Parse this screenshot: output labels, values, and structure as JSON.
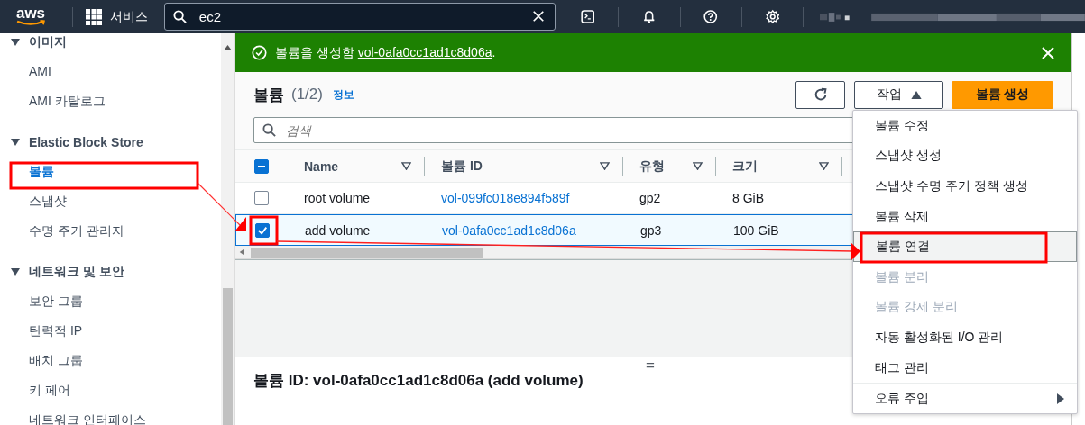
{
  "top_nav": {
    "logo": "aws",
    "services": "서비스",
    "search": {
      "value": "ec2"
    }
  },
  "sidebar": {
    "sections": [
      {
        "title": "이미지",
        "expanded": true,
        "items": [
          {
            "label": "AMI",
            "selected": false
          },
          {
            "label": "AMI 카탈로그",
            "selected": false
          }
        ]
      },
      {
        "title": "Elastic Block Store",
        "expanded": true,
        "items": [
          {
            "label": "볼륨",
            "selected": true
          },
          {
            "label": "스냅샷",
            "selected": false
          },
          {
            "label": "수명 주기 관리자",
            "selected": false
          }
        ]
      },
      {
        "title": "네트워크 및 보안",
        "expanded": true,
        "items": [
          {
            "label": "보안 그룹",
            "selected": false
          },
          {
            "label": "탄력적 IP",
            "selected": false
          },
          {
            "label": "배치 그룹",
            "selected": false
          },
          {
            "label": "키 페어",
            "selected": false
          },
          {
            "label": "네트워크 인터페이스",
            "selected": false
          }
        ]
      }
    ]
  },
  "flash": {
    "message": "볼륨을 생성함 ",
    "link": "vol-0afa0cc1ad1c8d06a",
    "suffix": "."
  },
  "volumes": {
    "title": "볼륨",
    "count": "(1/2)",
    "info": "정보",
    "actions_button": "작업",
    "create_button": "볼륨 생성",
    "search": {
      "placeholder": "검색"
    },
    "header_checkbox": {
      "indeterminate": true
    },
    "columns": [
      "Name",
      "볼륨 ID",
      "유형",
      "크기"
    ],
    "rows": [
      {
        "selected": false,
        "cells": [
          "root volume",
          "vol-099fc018e894f589f",
          "gp2",
          "8 GiB"
        ]
      },
      {
        "selected": true,
        "cells": [
          "add volume",
          "vol-0afa0cc1ad1c8d06a",
          "gp3",
          "100 GiB"
        ]
      }
    ]
  },
  "actions_menu": {
    "items": [
      {
        "kind": "item",
        "label": "볼륨 수정",
        "disabled": false,
        "highlighted": false
      },
      {
        "kind": "item",
        "label": "스냅샷 생성",
        "disabled": false,
        "highlighted": false
      },
      {
        "kind": "item",
        "label": "스냅샷 수명 주기 정책 생성",
        "disabled": false,
        "highlighted": false
      },
      {
        "kind": "item",
        "label": "볼륨 삭제",
        "disabled": false,
        "highlighted": false
      },
      {
        "kind": "item",
        "label": "볼륨 연결",
        "disabled": false,
        "highlighted": true
      },
      {
        "kind": "item",
        "label": "볼륨 분리",
        "disabled": true,
        "highlighted": false
      },
      {
        "kind": "item",
        "label": "볼륨 강제 분리",
        "disabled": true,
        "highlighted": false
      },
      {
        "kind": "item",
        "label": "자동 활성화된 I/O 관리",
        "disabled": false,
        "highlighted": false
      },
      {
        "kind": "item",
        "label": "태그 관리",
        "disabled": false,
        "highlighted": false
      },
      {
        "kind": "submenu",
        "label": "오류 주입",
        "disabled": false,
        "highlighted": false
      }
    ]
  },
  "details": {
    "handle": "=",
    "title": "볼륨 ID: vol-0afa0cc1ad1c8d06a (add volume)"
  }
}
